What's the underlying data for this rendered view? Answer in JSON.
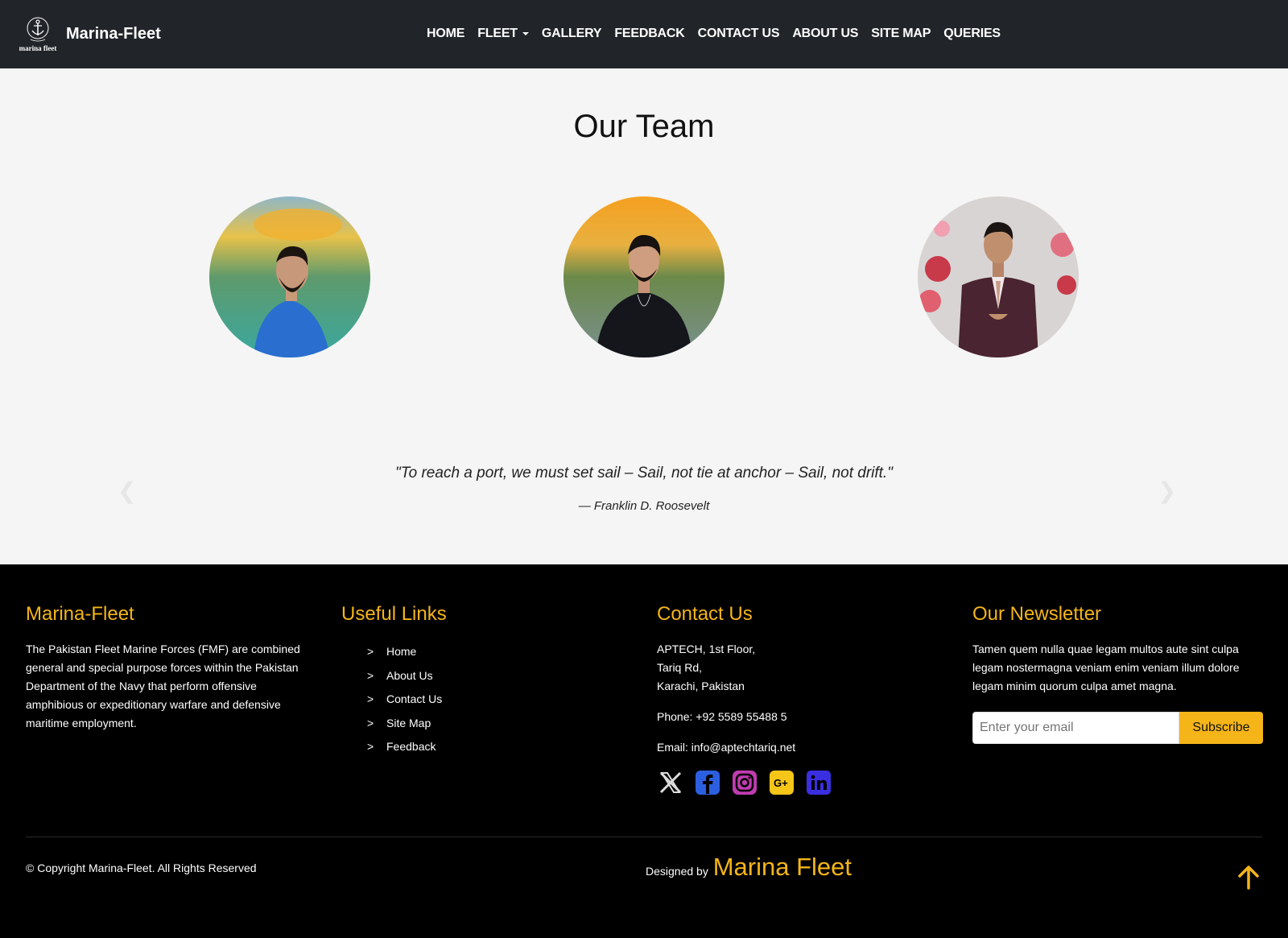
{
  "nav": {
    "brand": "Marina-Fleet",
    "logo_text": "marina fleet",
    "items": [
      "HOME",
      "FLEET",
      "GALLERY",
      "FEEDBACK",
      "CONTACT US",
      "ABOUT US",
      "SITE MAP",
      "QUERIES"
    ]
  },
  "team": {
    "title": "Our Team",
    "quote": "\"To reach a port, we must set sail – Sail, not tie at anchor – Sail, not drift.\"",
    "author": "— Franklin D. Roosevelt",
    "prev_icon": "chevron-left-icon",
    "next_icon": "chevron-right-icon"
  },
  "footer": {
    "about": {
      "title": "Marina-Fleet",
      "text": "The Pakistan Fleet Marine Forces (FMF) are combined general and special purpose forces within the Pakistan Department of the Navy that perform offensive amphibious or expeditionary warfare and defensive maritime employment."
    },
    "links": {
      "title": "Useful Links",
      "items": [
        "Home",
        "About Us",
        "Contact Us",
        "Site Map",
        "Feedback"
      ]
    },
    "contact": {
      "title": "Contact Us",
      "address1": "APTECH, 1st Floor,",
      "address2": "Tariq Rd,",
      "address3": "Karachi, Pakistan",
      "phone": "Phone: +92 5589 55488 5",
      "email": "Email: info@aptechtariq.net",
      "social_icons": [
        "x-icon",
        "facebook-icon",
        "instagram-icon",
        "google-plus-icon",
        "linkedin-icon"
      ]
    },
    "newsletter": {
      "title": "Our Newsletter",
      "text": "Tamen quem nulla quae legam multos aute sint culpa legam nostermagna veniam enim veniam illum dolore legam minim quorum culpa amet magna.",
      "placeholder": "Enter your email",
      "button": "Subscribe"
    },
    "copyright": "© Copyright Marina-Fleet. All Rights Reserved",
    "designed_by": "Designed by",
    "designer": "Marina Fleet"
  },
  "colors": {
    "accent": "#f5b519",
    "nav_bg": "#212529",
    "section_bg": "#f5f5f5"
  }
}
